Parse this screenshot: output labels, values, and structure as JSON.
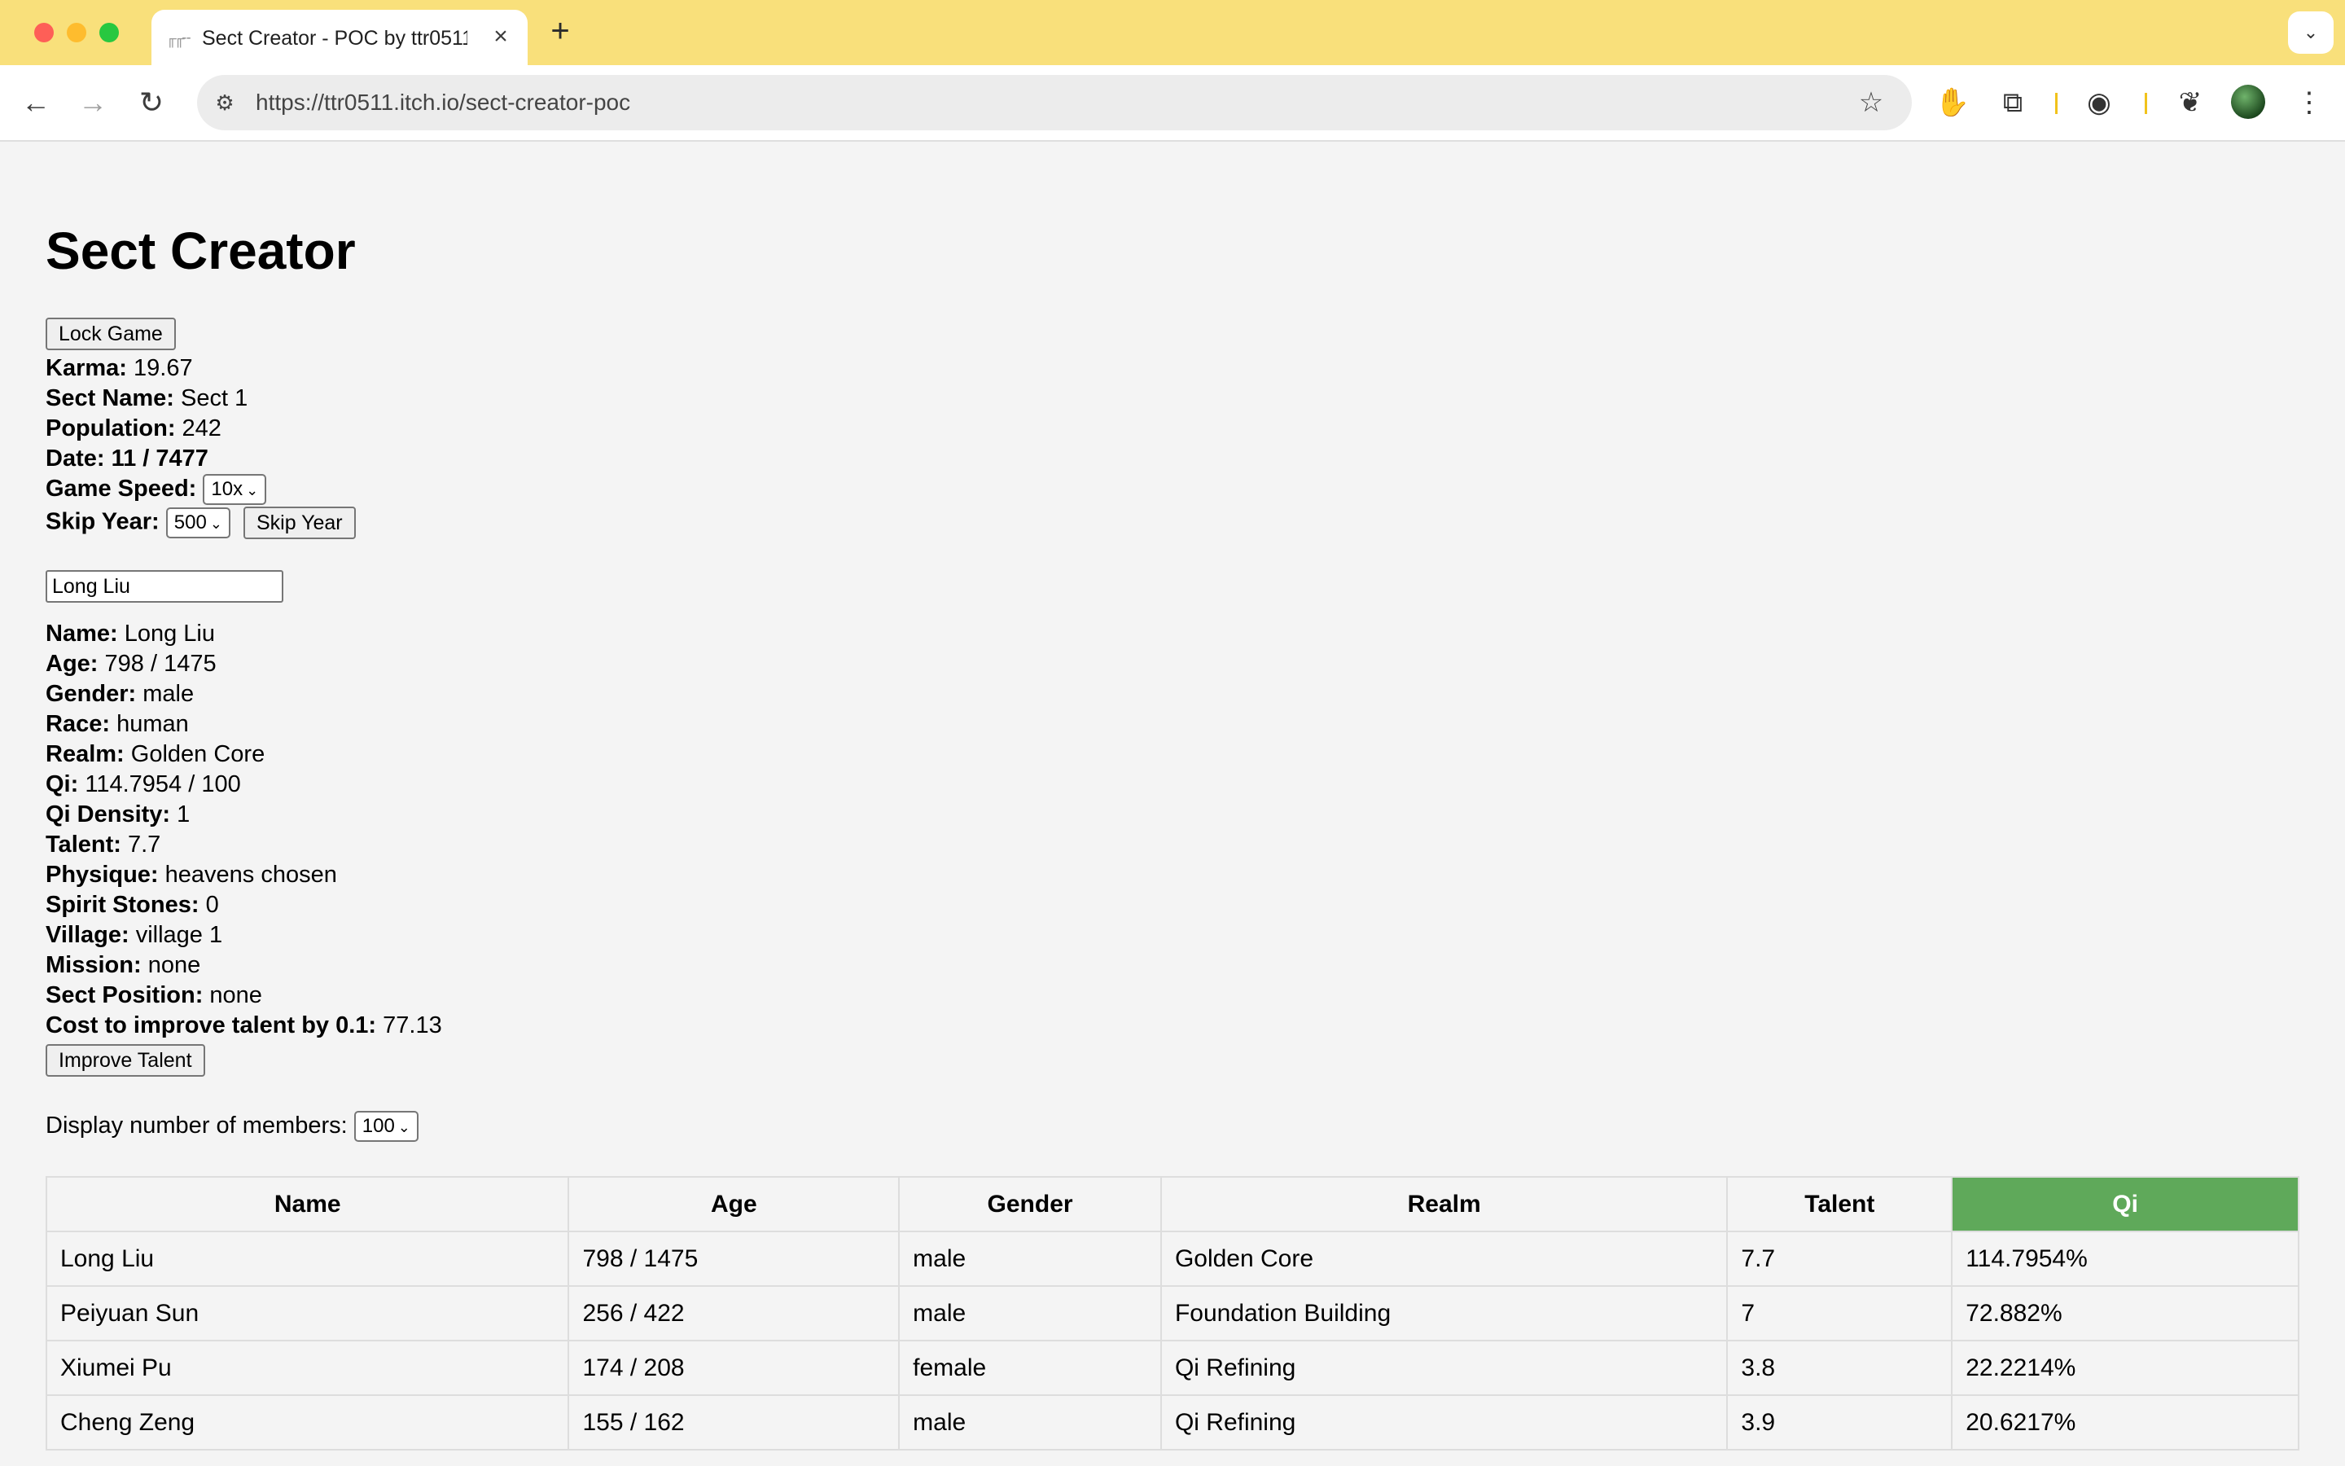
{
  "browser": {
    "tab_title": "Sect Creator - POC by ttr0511",
    "favicon": "itch-icon",
    "url": "https://ttr0511.itch.io/sect-creator-poc"
  },
  "game": {
    "title": "Sect Creator",
    "lock_button": "Lock Game",
    "karma_label": "Karma:",
    "karma": "19.67",
    "sect_name_label": "Sect Name:",
    "sect_name": "Sect 1",
    "population_label": "Population:",
    "population": "242",
    "date_label": "Date: 11 / 7477",
    "game_speed_label": "Game Speed:",
    "game_speed": "10x",
    "skip_year_label": "Skip Year:",
    "skip_year": "500",
    "skip_year_button": "Skip Year"
  },
  "member_search": {
    "value": "Long Liu"
  },
  "member": {
    "name_label": "Name:",
    "name": "Long Liu",
    "age_label": "Age:",
    "age": "798 / 1475",
    "gender_label": "Gender:",
    "gender": "male",
    "race_label": "Race:",
    "race": "human",
    "realm_label": "Realm:",
    "realm": "Golden Core",
    "qi_label": "Qi:",
    "qi": "114.7954 / 100",
    "qi_density_label": "Qi Density:",
    "qi_density": "1",
    "talent_label": "Talent:",
    "talent": "7.7",
    "physique_label": "Physique:",
    "physique": "heavens chosen",
    "spirit_stones_label": "Spirit Stones:",
    "spirit_stones": "0",
    "village_label": "Village:",
    "village": "village 1",
    "mission_label": "Mission:",
    "mission": "none",
    "sect_position_label": "Sect Position:",
    "sect_position": "none",
    "cost_label": "Cost to improve talent by 0.1:",
    "cost": "77.13",
    "improve_button": "Improve Talent"
  },
  "display": {
    "label": "Display number of members:",
    "value": "100"
  },
  "table": {
    "headers": [
      "Name",
      "Age",
      "Gender",
      "Realm",
      "Talent",
      "Qi"
    ],
    "sorted_column": "Qi",
    "sorted_color": "#5fa95a",
    "rows": [
      [
        "Long Liu",
        "798 / 1475",
        "male",
        "Golden Core",
        "7.7",
        "114.7954%"
      ],
      [
        "Peiyuan Sun",
        "256 / 422",
        "male",
        "Foundation Building",
        "7",
        "72.882%"
      ],
      [
        "Xiumei Pu",
        "174 / 208",
        "female",
        "Qi Refining",
        "3.8",
        "22.2214%"
      ],
      [
        "Cheng Zeng",
        "155 / 162",
        "male",
        "Qi Refining",
        "3.9",
        "20.6217%"
      ]
    ]
  }
}
